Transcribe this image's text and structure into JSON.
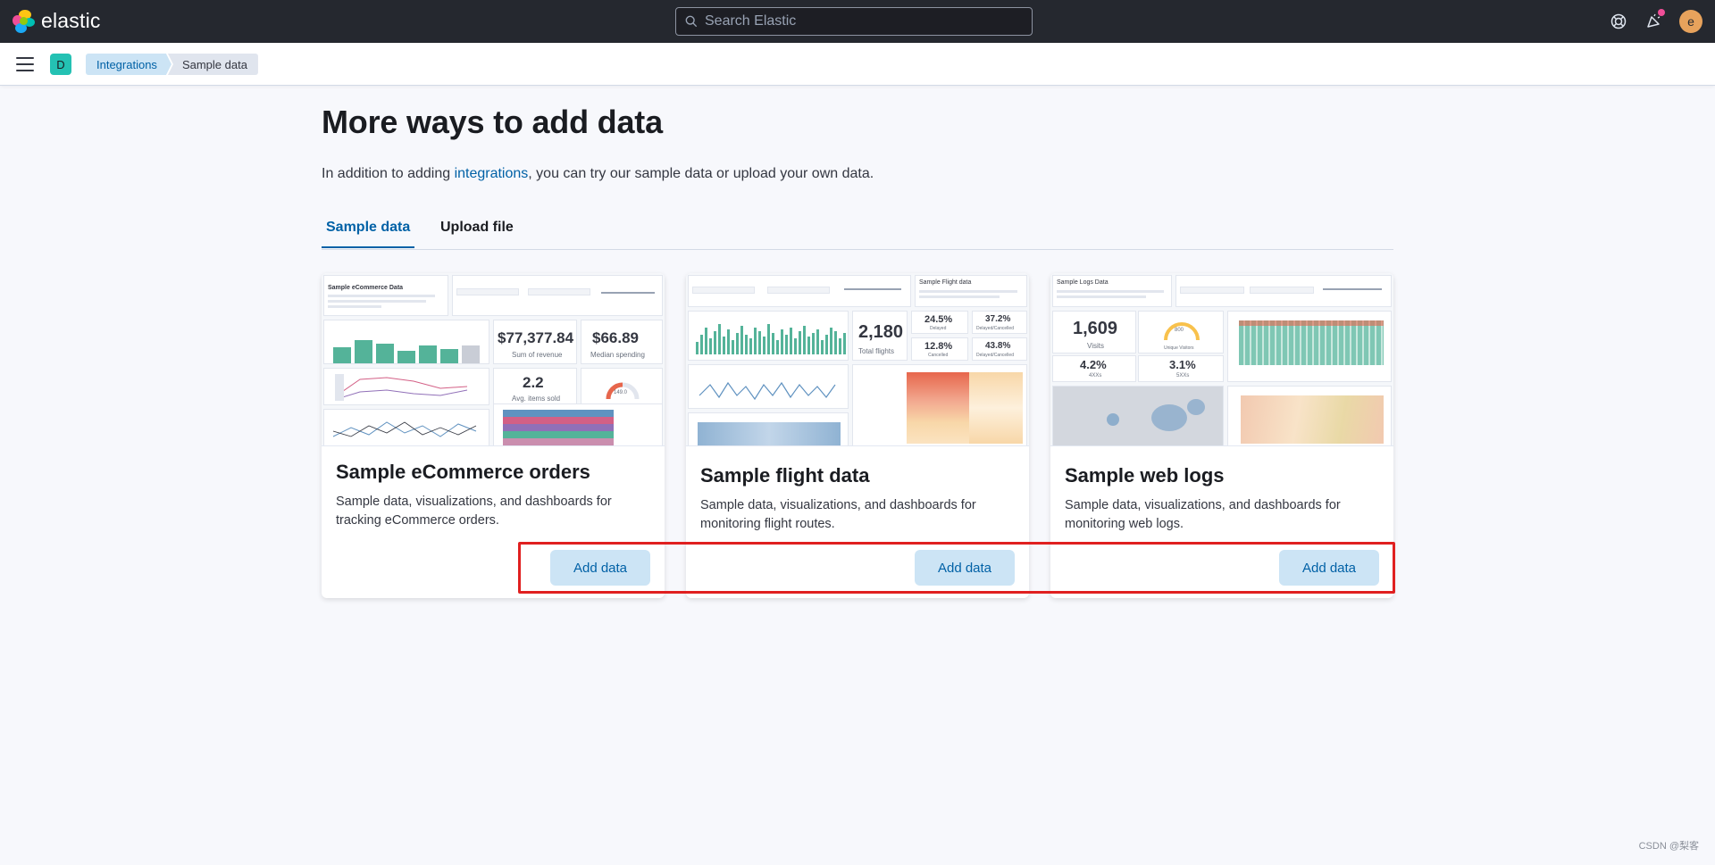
{
  "header": {
    "brand": "elastic",
    "search_placeholder": "Search Elastic",
    "avatar_initial": "e",
    "icons": [
      "help-icon",
      "newsfeed-icon"
    ]
  },
  "subheader": {
    "space_initial": "D",
    "breadcrumbs": [
      "Integrations",
      "Sample data"
    ]
  },
  "page": {
    "title": "More ways to add data",
    "intro_prefix": "In addition to adding ",
    "intro_link": "integrations",
    "intro_suffix": ", you can try our sample data or upload your own data.",
    "tabs": [
      "Sample data",
      "Upload file"
    ],
    "active_tab": "Sample data"
  },
  "cards": [
    {
      "title": "Sample eCommerce orders",
      "description": "Sample data, visualizations, and dashboards for tracking eCommerce orders.",
      "button": "Add data",
      "thumb": {
        "heading": "Sample eCommerce Data",
        "metric1": "$77,377.84",
        "metric1_label": "Sum of revenue",
        "metric2": "$66.89",
        "metric2_label": "Median spending",
        "metric3": "2.2",
        "metric3_label": "Avg. items sold",
        "gauge_value": "149.0"
      }
    },
    {
      "title": "Sample flight data",
      "description": "Sample data, visualizations, and dashboards for monitoring flight routes.",
      "button": "Add data",
      "thumb": {
        "heading": "Sample Flight data",
        "metric1": "2,180",
        "metric1_label": "Total flights",
        "pct1": "24.5%",
        "pct1_label": "Delayed",
        "pct2": "37.2%",
        "pct2_label": "Delayed/Cancelled",
        "pct3": "12.8%",
        "pct3_label": "Cancelled",
        "pct4": "43.8%",
        "pct4_label": "Delayed/Cancelled"
      }
    },
    {
      "title": "Sample web logs",
      "description": "Sample data, visualizations, and dashboards for monitoring web logs.",
      "button": "Add data",
      "thumb": {
        "heading": "Sample Logs Data",
        "metric1": "1,609",
        "metric1_label": "Visits",
        "gauge_value": "800",
        "gauge_label": "Unique Visitors",
        "pct1": "4.2%",
        "pct1_label": "4XXs",
        "pct2": "3.1%",
        "pct2_label": "5XXs"
      }
    }
  ],
  "watermark": "CSDN @梨客"
}
